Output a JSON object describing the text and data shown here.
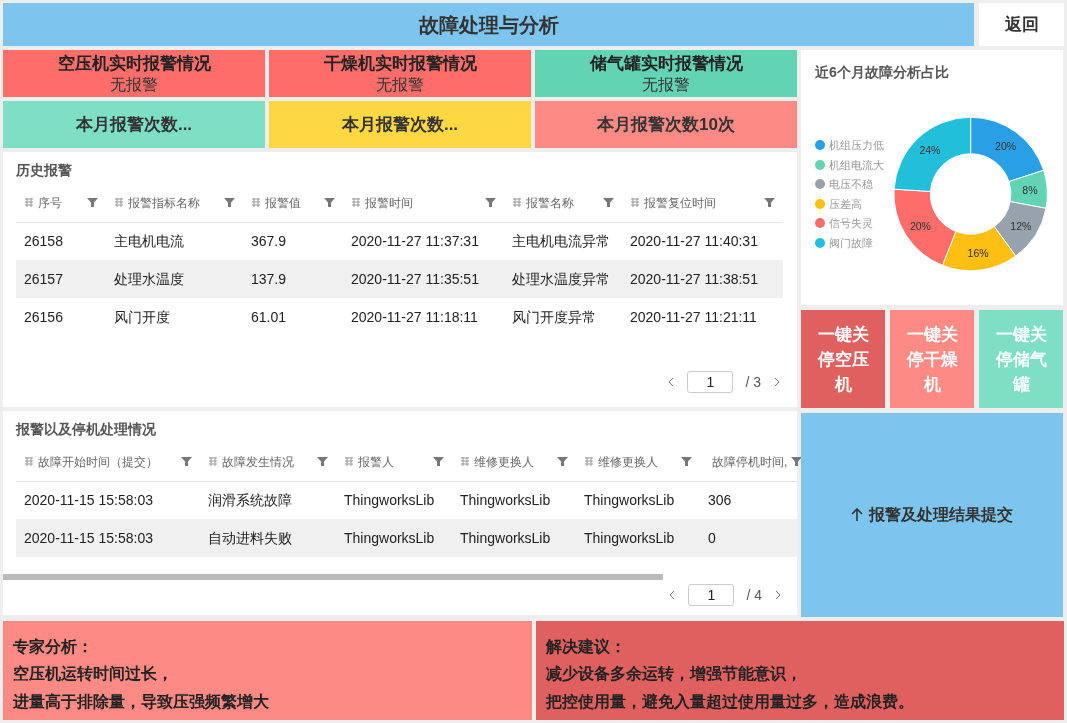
{
  "header": {
    "title": "故障处理与分析",
    "back_button": "返回"
  },
  "alarm_cards": [
    {
      "title": "空压机实时报警情况",
      "status": "无报警",
      "color": "#fd6e6b"
    },
    {
      "title": "干燥机实时报警情况",
      "status": "无报警",
      "color": "#fd6e6b"
    },
    {
      "title": "储气罐实时报警情况",
      "status": "无报警",
      "color": "#62d4b3"
    }
  ],
  "monthly_counts": [
    {
      "text": "本月报警次数...",
      "color": "#7edfc4"
    },
    {
      "text": "本月报警次数...",
      "color": "#fdd843"
    },
    {
      "text": "本月报警次数10次",
      "color": "#fd8a85"
    }
  ],
  "history": {
    "title": "历史报警",
    "columns": [
      "序号",
      "报警指标名称",
      "报警值",
      "报警时间",
      "报警名称",
      "报警复位时间"
    ],
    "rows": [
      [
        "26158",
        "主电机电流",
        "367.9",
        "2020-11-27 11:37:31",
        "主电机电流异常",
        "2020-11-27 11:40:31"
      ],
      [
        "26157",
        "处理水温度",
        "137.9",
        "2020-11-27 11:35:51",
        "处理水温度异常",
        "2020-11-27 11:38:51"
      ],
      [
        "26156",
        "风门开度",
        "61.01",
        "2020-11-27 11:18:11",
        "风门开度异常",
        "2020-11-27 11:21:11"
      ]
    ],
    "pagination": {
      "page": "1",
      "total": "/ 3"
    }
  },
  "chart": {
    "title": "近6个月故障分析占比",
    "chart_data": {
      "type": "donut",
      "categories": [
        "机组压力低",
        "机组电流大",
        "电压不稳",
        "压差高",
        "信号失灵",
        "阀门故障"
      ],
      "values": [
        20,
        8,
        12,
        16,
        20,
        24
      ],
      "legend": "left",
      "colors": [
        "#29a0e6",
        "#62d4b3",
        "#97a2ac",
        "#fdc012",
        "#fd6e6b",
        "#22bfdb"
      ],
      "value_labels": [
        "20%",
        "8%",
        "12%",
        "16%",
        "20%",
        "24%"
      ]
    }
  },
  "shutdown_buttons": [
    {
      "label": "一键关停空压机",
      "color": "#e06060"
    },
    {
      "label": "一键关停干燥机",
      "color": "#fd8a85"
    },
    {
      "label": "一键关停储气罐",
      "color": "#7edfc4"
    }
  ],
  "handling": {
    "title": "报警以及停机处理情况",
    "columns": [
      "故障开始时间（提交）",
      "故障发生情况",
      "报警人",
      "维修更换人",
      "维修更换人",
      "故障停机时间,"
    ],
    "rows": [
      [
        "2020-11-15 15:58:03",
        "润滑系统故障",
        "ThingworksLib",
        "ThingworksLib",
        "ThingworksLib",
        "306"
      ],
      [
        "2020-11-15 15:58:03",
        "自动进料失败",
        "ThingworksLib",
        "ThingworksLib",
        "ThingworksLib",
        "0"
      ]
    ],
    "pagination": {
      "page": "1",
      "total": "/ 4"
    }
  },
  "submit_button": {
    "label": "报警及处理结果提交"
  },
  "analysis": {
    "title": "专家分析：",
    "lines": [
      "空压机运转时间过长，",
      "进量高于排除量，导致压强频繁增大"
    ]
  },
  "suggestion": {
    "title": "解决建议：",
    "lines": [
      "减少设备多余运转，增强节能意识，",
      "把控使用量，避免入量超过使用量过多，造成浪费。"
    ]
  }
}
